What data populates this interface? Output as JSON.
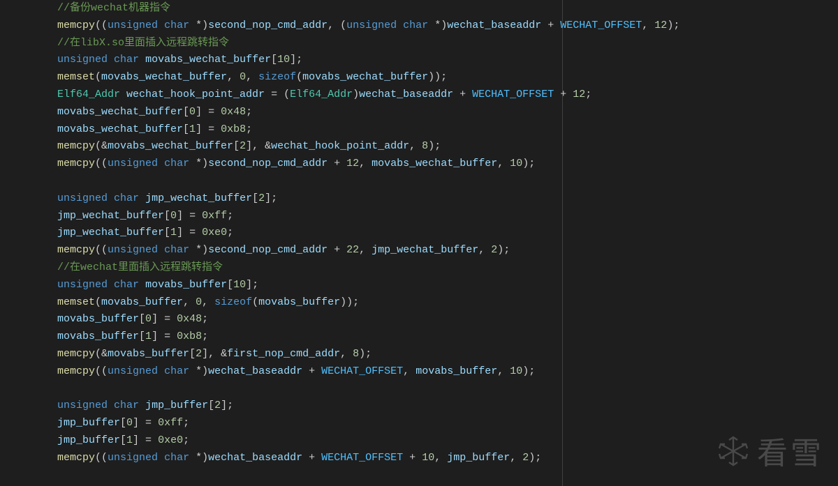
{
  "watermark": {
    "text": "看雪",
    "icon": "snowflake-icon"
  },
  "code": {
    "lines": [
      {
        "tokens": [
          {
            "cls": "c",
            "t": "//备份wechat机器指令"
          }
        ]
      },
      {
        "tokens": [
          {
            "cls": "fn",
            "t": "memcpy"
          },
          {
            "cls": "op",
            "t": "(("
          },
          {
            "cls": "kw",
            "t": "unsigned"
          },
          {
            "cls": "op",
            "t": " "
          },
          {
            "cls": "kw",
            "t": "char"
          },
          {
            "cls": "op",
            "t": " *)"
          },
          {
            "cls": "id",
            "t": "second_nop_cmd_addr"
          },
          {
            "cls": "op",
            "t": ", ("
          },
          {
            "cls": "kw",
            "t": "unsigned"
          },
          {
            "cls": "op",
            "t": " "
          },
          {
            "cls": "kw",
            "t": "char"
          },
          {
            "cls": "op",
            "t": " *)"
          },
          {
            "cls": "id",
            "t": "wechat_baseaddr"
          },
          {
            "cls": "op",
            "t": " + "
          },
          {
            "cls": "mc",
            "t": "WECHAT_OFFSET"
          },
          {
            "cls": "op",
            "t": ", "
          },
          {
            "cls": "nu",
            "t": "12"
          },
          {
            "cls": "op",
            "t": ");"
          }
        ]
      },
      {
        "tokens": [
          {
            "cls": "c",
            "t": "//在libX.so里面插入远程跳转指令"
          }
        ]
      },
      {
        "tokens": [
          {
            "cls": "kw",
            "t": "unsigned"
          },
          {
            "cls": "op",
            "t": " "
          },
          {
            "cls": "kw",
            "t": "char"
          },
          {
            "cls": "op",
            "t": " "
          },
          {
            "cls": "id",
            "t": "movabs_wechat_buffer"
          },
          {
            "cls": "op",
            "t": "["
          },
          {
            "cls": "nu",
            "t": "10"
          },
          {
            "cls": "op",
            "t": "];"
          }
        ]
      },
      {
        "tokens": [
          {
            "cls": "fn",
            "t": "memset"
          },
          {
            "cls": "op",
            "t": "("
          },
          {
            "cls": "id",
            "t": "movabs_wechat_buffer"
          },
          {
            "cls": "op",
            "t": ", "
          },
          {
            "cls": "nu",
            "t": "0"
          },
          {
            "cls": "op",
            "t": ", "
          },
          {
            "cls": "kw",
            "t": "sizeof"
          },
          {
            "cls": "op",
            "t": "("
          },
          {
            "cls": "id",
            "t": "movabs_wechat_buffer"
          },
          {
            "cls": "op",
            "t": "));"
          }
        ]
      },
      {
        "tokens": [
          {
            "cls": "ty",
            "t": "Elf64_Addr"
          },
          {
            "cls": "op",
            "t": " "
          },
          {
            "cls": "id",
            "t": "wechat_hook_point_addr"
          },
          {
            "cls": "op",
            "t": " = ("
          },
          {
            "cls": "ty",
            "t": "Elf64_Addr"
          },
          {
            "cls": "op",
            "t": ")"
          },
          {
            "cls": "id",
            "t": "wechat_baseaddr"
          },
          {
            "cls": "op",
            "t": " + "
          },
          {
            "cls": "mc",
            "t": "WECHAT_OFFSET"
          },
          {
            "cls": "op",
            "t": " + "
          },
          {
            "cls": "nu",
            "t": "12"
          },
          {
            "cls": "op",
            "t": ";"
          }
        ]
      },
      {
        "tokens": [
          {
            "cls": "id",
            "t": "movabs_wechat_buffer"
          },
          {
            "cls": "op",
            "t": "["
          },
          {
            "cls": "nu",
            "t": "0"
          },
          {
            "cls": "op",
            "t": "] = "
          },
          {
            "cls": "nu",
            "t": "0x48"
          },
          {
            "cls": "op",
            "t": ";"
          }
        ]
      },
      {
        "tokens": [
          {
            "cls": "id",
            "t": "movabs_wechat_buffer"
          },
          {
            "cls": "op",
            "t": "["
          },
          {
            "cls": "nu",
            "t": "1"
          },
          {
            "cls": "op",
            "t": "] = "
          },
          {
            "cls": "nu",
            "t": "0xb8"
          },
          {
            "cls": "op",
            "t": ";"
          }
        ]
      },
      {
        "tokens": [
          {
            "cls": "fn",
            "t": "memcpy"
          },
          {
            "cls": "op",
            "t": "(&"
          },
          {
            "cls": "id",
            "t": "movabs_wechat_buffer"
          },
          {
            "cls": "op",
            "t": "["
          },
          {
            "cls": "nu",
            "t": "2"
          },
          {
            "cls": "op",
            "t": "], &"
          },
          {
            "cls": "id",
            "t": "wechat_hook_point_addr"
          },
          {
            "cls": "op",
            "t": ", "
          },
          {
            "cls": "nu",
            "t": "8"
          },
          {
            "cls": "op",
            "t": ");"
          }
        ]
      },
      {
        "tokens": [
          {
            "cls": "fn",
            "t": "memcpy"
          },
          {
            "cls": "op",
            "t": "(("
          },
          {
            "cls": "kw",
            "t": "unsigned"
          },
          {
            "cls": "op",
            "t": " "
          },
          {
            "cls": "kw",
            "t": "char"
          },
          {
            "cls": "op",
            "t": " *)"
          },
          {
            "cls": "id",
            "t": "second_nop_cmd_addr"
          },
          {
            "cls": "op",
            "t": " + "
          },
          {
            "cls": "nu",
            "t": "12"
          },
          {
            "cls": "op",
            "t": ", "
          },
          {
            "cls": "id",
            "t": "movabs_wechat_buffer"
          },
          {
            "cls": "op",
            "t": ", "
          },
          {
            "cls": "nu",
            "t": "10"
          },
          {
            "cls": "op",
            "t": ");"
          }
        ]
      },
      {
        "tokens": []
      },
      {
        "tokens": [
          {
            "cls": "kw",
            "t": "unsigned"
          },
          {
            "cls": "op",
            "t": " "
          },
          {
            "cls": "kw",
            "t": "char"
          },
          {
            "cls": "op",
            "t": " "
          },
          {
            "cls": "id",
            "t": "jmp_wechat_buffer"
          },
          {
            "cls": "op",
            "t": "["
          },
          {
            "cls": "nu",
            "t": "2"
          },
          {
            "cls": "op",
            "t": "];"
          }
        ]
      },
      {
        "tokens": [
          {
            "cls": "id",
            "t": "jmp_wechat_buffer"
          },
          {
            "cls": "op",
            "t": "["
          },
          {
            "cls": "nu",
            "t": "0"
          },
          {
            "cls": "op",
            "t": "] = "
          },
          {
            "cls": "nu",
            "t": "0xff"
          },
          {
            "cls": "op",
            "t": ";"
          }
        ]
      },
      {
        "tokens": [
          {
            "cls": "id",
            "t": "jmp_wechat_buffer"
          },
          {
            "cls": "op",
            "t": "["
          },
          {
            "cls": "nu",
            "t": "1"
          },
          {
            "cls": "op",
            "t": "] = "
          },
          {
            "cls": "nu",
            "t": "0xe0"
          },
          {
            "cls": "op",
            "t": ";"
          }
        ]
      },
      {
        "tokens": [
          {
            "cls": "fn",
            "t": "memcpy"
          },
          {
            "cls": "op",
            "t": "(("
          },
          {
            "cls": "kw",
            "t": "unsigned"
          },
          {
            "cls": "op",
            "t": " "
          },
          {
            "cls": "kw",
            "t": "char"
          },
          {
            "cls": "op",
            "t": " *)"
          },
          {
            "cls": "id",
            "t": "second_nop_cmd_addr"
          },
          {
            "cls": "op",
            "t": " + "
          },
          {
            "cls": "nu",
            "t": "22"
          },
          {
            "cls": "op",
            "t": ", "
          },
          {
            "cls": "id",
            "t": "jmp_wechat_buffer"
          },
          {
            "cls": "op",
            "t": ", "
          },
          {
            "cls": "nu",
            "t": "2"
          },
          {
            "cls": "op",
            "t": ");"
          }
        ]
      },
      {
        "tokens": [
          {
            "cls": "c",
            "t": "//在wechat里面插入远程跳转指令"
          }
        ]
      },
      {
        "tokens": [
          {
            "cls": "kw",
            "t": "unsigned"
          },
          {
            "cls": "op",
            "t": " "
          },
          {
            "cls": "kw",
            "t": "char"
          },
          {
            "cls": "op",
            "t": " "
          },
          {
            "cls": "id",
            "t": "movabs_buffer"
          },
          {
            "cls": "op",
            "t": "["
          },
          {
            "cls": "nu",
            "t": "10"
          },
          {
            "cls": "op",
            "t": "];"
          }
        ]
      },
      {
        "tokens": [
          {
            "cls": "fn",
            "t": "memset"
          },
          {
            "cls": "op",
            "t": "("
          },
          {
            "cls": "id",
            "t": "movabs_buffer"
          },
          {
            "cls": "op",
            "t": ", "
          },
          {
            "cls": "nu",
            "t": "0"
          },
          {
            "cls": "op",
            "t": ", "
          },
          {
            "cls": "kw",
            "t": "sizeof"
          },
          {
            "cls": "op",
            "t": "("
          },
          {
            "cls": "id",
            "t": "movabs_buffer"
          },
          {
            "cls": "op",
            "t": "));"
          }
        ]
      },
      {
        "tokens": [
          {
            "cls": "id",
            "t": "movabs_buffer"
          },
          {
            "cls": "op",
            "t": "["
          },
          {
            "cls": "nu",
            "t": "0"
          },
          {
            "cls": "op",
            "t": "] = "
          },
          {
            "cls": "nu",
            "t": "0x48"
          },
          {
            "cls": "op",
            "t": ";"
          }
        ]
      },
      {
        "tokens": [
          {
            "cls": "id",
            "t": "movabs_buffer"
          },
          {
            "cls": "op",
            "t": "["
          },
          {
            "cls": "nu",
            "t": "1"
          },
          {
            "cls": "op",
            "t": "] = "
          },
          {
            "cls": "nu",
            "t": "0xb8"
          },
          {
            "cls": "op",
            "t": ";"
          }
        ]
      },
      {
        "tokens": [
          {
            "cls": "fn",
            "t": "memcpy"
          },
          {
            "cls": "op",
            "t": "(&"
          },
          {
            "cls": "id",
            "t": "movabs_buffer"
          },
          {
            "cls": "op",
            "t": "["
          },
          {
            "cls": "nu",
            "t": "2"
          },
          {
            "cls": "op",
            "t": "], &"
          },
          {
            "cls": "id",
            "t": "first_nop_cmd_addr"
          },
          {
            "cls": "op",
            "t": ", "
          },
          {
            "cls": "nu",
            "t": "8"
          },
          {
            "cls": "op",
            "t": ");"
          }
        ]
      },
      {
        "tokens": [
          {
            "cls": "fn",
            "t": "memcpy"
          },
          {
            "cls": "op",
            "t": "(("
          },
          {
            "cls": "kw",
            "t": "unsigned"
          },
          {
            "cls": "op",
            "t": " "
          },
          {
            "cls": "kw",
            "t": "char"
          },
          {
            "cls": "op",
            "t": " *)"
          },
          {
            "cls": "id",
            "t": "wechat_baseaddr"
          },
          {
            "cls": "op",
            "t": " + "
          },
          {
            "cls": "mc",
            "t": "WECHAT_OFFSET"
          },
          {
            "cls": "op",
            "t": ", "
          },
          {
            "cls": "id",
            "t": "movabs_buffer"
          },
          {
            "cls": "op",
            "t": ", "
          },
          {
            "cls": "nu",
            "t": "10"
          },
          {
            "cls": "op",
            "t": ");"
          }
        ]
      },
      {
        "tokens": []
      },
      {
        "tokens": [
          {
            "cls": "kw",
            "t": "unsigned"
          },
          {
            "cls": "op",
            "t": " "
          },
          {
            "cls": "kw",
            "t": "char"
          },
          {
            "cls": "op",
            "t": " "
          },
          {
            "cls": "id",
            "t": "jmp_buffer"
          },
          {
            "cls": "op",
            "t": "["
          },
          {
            "cls": "nu",
            "t": "2"
          },
          {
            "cls": "op",
            "t": "];"
          }
        ]
      },
      {
        "tokens": [
          {
            "cls": "id",
            "t": "jmp_buffer"
          },
          {
            "cls": "op",
            "t": "["
          },
          {
            "cls": "nu",
            "t": "0"
          },
          {
            "cls": "op",
            "t": "] = "
          },
          {
            "cls": "nu",
            "t": "0xff"
          },
          {
            "cls": "op",
            "t": ";"
          }
        ]
      },
      {
        "tokens": [
          {
            "cls": "id",
            "t": "jmp_buffer"
          },
          {
            "cls": "op",
            "t": "["
          },
          {
            "cls": "nu",
            "t": "1"
          },
          {
            "cls": "op",
            "t": "] = "
          },
          {
            "cls": "nu",
            "t": "0xe0"
          },
          {
            "cls": "op",
            "t": ";"
          }
        ]
      },
      {
        "tokens": [
          {
            "cls": "fn",
            "t": "memcpy"
          },
          {
            "cls": "op",
            "t": "(("
          },
          {
            "cls": "kw",
            "t": "unsigned"
          },
          {
            "cls": "op",
            "t": " "
          },
          {
            "cls": "kw",
            "t": "char"
          },
          {
            "cls": "op",
            "t": " *)"
          },
          {
            "cls": "id",
            "t": "wechat_baseaddr"
          },
          {
            "cls": "op",
            "t": " + "
          },
          {
            "cls": "mc",
            "t": "WECHAT_OFFSET"
          },
          {
            "cls": "op",
            "t": " + "
          },
          {
            "cls": "nu",
            "t": "10"
          },
          {
            "cls": "op",
            "t": ", "
          },
          {
            "cls": "id",
            "t": "jmp_buffer"
          },
          {
            "cls": "op",
            "t": ", "
          },
          {
            "cls": "nu",
            "t": "2"
          },
          {
            "cls": "op",
            "t": ");"
          }
        ]
      }
    ]
  }
}
